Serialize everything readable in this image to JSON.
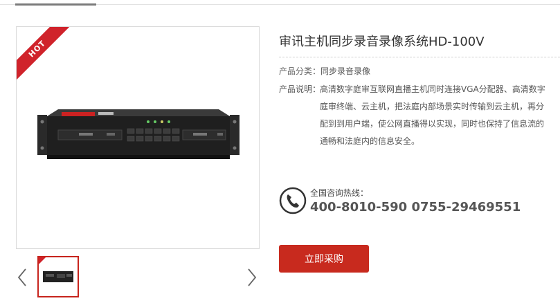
{
  "product": {
    "title": "审讯主机同步录音录像系统HD-100V",
    "hot_badge": "HOT",
    "category_label": "产品分类：",
    "category_value": "同步录音录像",
    "description_label": "产品说明：",
    "description_value": "高清数字庭审互联网直播主机同时连接VGA分配器、高清数字庭审终端、云主机，把法庭内部场景实时传输到云主机，再分配到到用户端，使公网直播得以实现，同时也保持了信息流的通畅和法庭内的信息安全。"
  },
  "hotline": {
    "label": "全国咨询热线：",
    "number": "400-8010-590 0755-29469551",
    "icon": "phone-icon"
  },
  "actions": {
    "buy_label": "立即采购"
  },
  "gallery": {
    "prev_icon": "chevron-left-icon",
    "next_icon": "chevron-right-icon"
  },
  "colors": {
    "accent": "#c82a1e",
    "hot_badge": "#d0232b"
  }
}
